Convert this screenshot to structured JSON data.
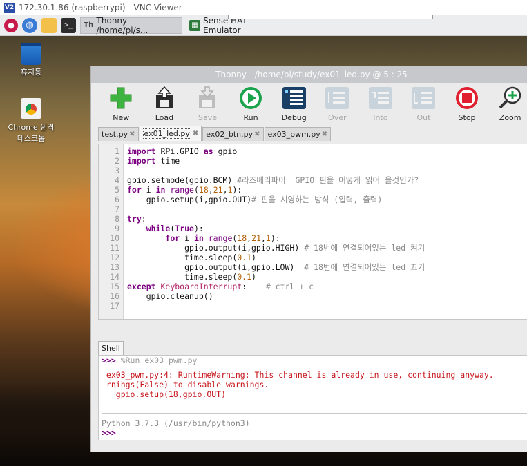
{
  "vnc": {
    "title": "172.30.1.86 (raspberrypi) - VNC Viewer",
    "logo_text": "V2"
  },
  "taskbar": {
    "tasks": [
      {
        "label": "Thonny  -  /home/pi/s...",
        "glyph": "Th"
      },
      {
        "label": "Sense HAT Emulator"
      }
    ]
  },
  "desktop": {
    "icons": [
      {
        "label": "휴지통"
      },
      {
        "label": "Chrome 원격 데스크톱"
      }
    ]
  },
  "thonny": {
    "title": "Thonny  -  /home/pi/study/ex01_led.py  @  5 : 25",
    "toolbar": [
      {
        "label": "New",
        "icon": "new-file-icon",
        "enabled": true
      },
      {
        "label": "Load",
        "icon": "load-icon",
        "enabled": true
      },
      {
        "label": "Save",
        "icon": "save-icon",
        "enabled": false
      },
      {
        "label": "Run",
        "icon": "run-icon",
        "enabled": true
      },
      {
        "label": "Debug",
        "icon": "debug-icon",
        "enabled": true
      },
      {
        "label": "Over",
        "icon": "step-over-icon",
        "enabled": false
      },
      {
        "label": "Into",
        "icon": "step-into-icon",
        "enabled": false
      },
      {
        "label": "Out",
        "icon": "step-out-icon",
        "enabled": false
      },
      {
        "label": "Stop",
        "icon": "stop-icon",
        "enabled": true
      },
      {
        "label": "Zoom",
        "icon": "zoom-icon",
        "enabled": true
      }
    ],
    "tabs": [
      {
        "label": "test.py",
        "active": false
      },
      {
        "label": "ex01_led.py",
        "active": true
      },
      {
        "label": "ex02_btn.py",
        "active": false
      },
      {
        "label": "ex03_pwm.py",
        "active": false
      }
    ],
    "tab_close": "✖",
    "line_numbers": [
      "1",
      "2",
      "3",
      "4",
      "5",
      "6",
      "7",
      "8",
      "9",
      "10",
      "11",
      "12",
      "13",
      "14",
      "15",
      "16",
      "17"
    ],
    "code": {
      "l1": {
        "kw1": "import",
        "t1": " RPi.GPIO ",
        "kw2": "as",
        "t2": " gpio"
      },
      "l2": {
        "kw1": "import",
        "t1": " time"
      },
      "l4": {
        "t1": "gpio.setmode(gpio.BCM) ",
        "cm": "#라즈베리파이  GPIO 핀을 어떻게 읽어 올것인가?"
      },
      "l5": {
        "kw1": "for",
        "t1": " i ",
        "kw2": "in",
        "t2": " ",
        "bi": "range",
        "t3": "(",
        "n1": "18",
        "t4": ",",
        "n2": "21",
        "t5": ",",
        "n3": "1",
        "t6": "):"
      },
      "l6": {
        "t1": "    gpio.setup(i,gpio.OUT)",
        "cm": "# 핀을 시영하는 방식 (입력, 출력)"
      },
      "l8": {
        "kw1": "try",
        "t1": ":"
      },
      "l9": {
        "t0": "    ",
        "kw1": "while",
        "t1": "(",
        "kw2": "True",
        "t2": "):"
      },
      "l10": {
        "t0": "        ",
        "kw1": "for",
        "t1": " i ",
        "kw2": "in",
        "t2": " ",
        "bi": "range",
        "t3": "(",
        "n1": "18",
        "t4": ",",
        "n2": "21",
        "t5": ",",
        "n3": "1",
        "t6": "):"
      },
      "l11": {
        "t1": "            gpio.output(i,gpio.HIGH) ",
        "cm": "# 18번에 연결되어있는 led 켜기"
      },
      "l12": {
        "t1": "            time.sleep(",
        "n1": "0.1",
        "t2": ")"
      },
      "l13": {
        "t1": "            gpio.output(i,gpio.LOW)  ",
        "cm": "# 18번에 연결되어있는 led 끄기"
      },
      "l14": {
        "t1": "            time.sleep(",
        "n1": "0.1",
        "t2": ")"
      },
      "l15": {
        "kw1": "except",
        "t1": " ",
        "exc": "KeyboardInterrupt",
        "t2": ":    ",
        "cm": "# ctrl + c"
      },
      "l16": {
        "t1": "    gpio.cleanup()"
      }
    },
    "shell": {
      "tab_label": "Shell",
      "prompt": ">>>",
      "run_cmd": " %Run ex03_pwm.py",
      "error_lines": [
        " ex03_pwm.py:4: RuntimeWarning: This channel is already in use, continuing anyway.",
        " rnings(False) to disable warnings.",
        "   gpio.setup(18,gpio.OUT)"
      ],
      "version": "Python 3.7.3 (/usr/bin/python3)"
    }
  },
  "colors": {
    "keyword": "#7a0080",
    "number": "#b45f06",
    "comment": "#888888",
    "error": "#c6161c",
    "run_green": "#1aa34a",
    "stop_red": "#e02030"
  }
}
